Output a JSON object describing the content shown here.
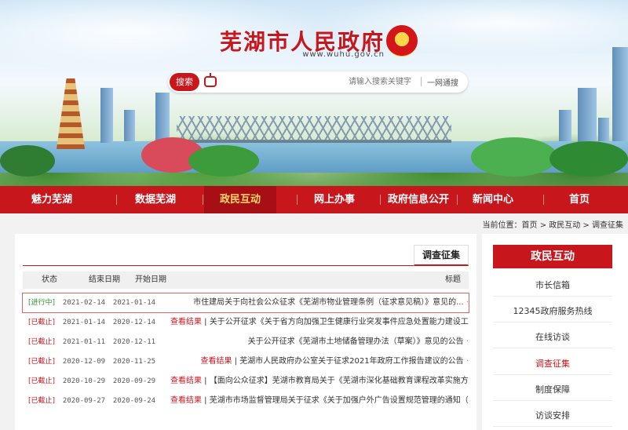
{
  "site": {
    "name": "芜湖市人民政府",
    "url": "www.wuhu.gov.cn"
  },
  "search": {
    "button_label": "搜索",
    "placeholder": "请输入搜索关键字",
    "scope_label": "一网通搜"
  },
  "nav": {
    "items": [
      {
        "label": "首页"
      },
      {
        "label": "新闻中心"
      },
      {
        "label": "政府信息公开"
      },
      {
        "label": "网上办事"
      },
      {
        "label": "政民互动",
        "active": true
      },
      {
        "label": "数据芜湖"
      },
      {
        "label": "魅力芜湖"
      }
    ]
  },
  "breadcrumb": "当前位置：首页 > 政民互动 > 调查征集",
  "sidebar": {
    "title": "政民互动",
    "items": [
      {
        "label": "市长信箱"
      },
      {
        "label": "12345政府服务热线"
      },
      {
        "label": "在线访谈"
      },
      {
        "label": "调查征集",
        "active": true
      },
      {
        "label": "制度保障"
      },
      {
        "label": "访谈安排"
      }
    ]
  },
  "main": {
    "tab_label": "调查征集",
    "columns": {
      "title": "标题",
      "start": "开始日期",
      "end": "结束日期",
      "status": "状态"
    },
    "rows": [
      {
        "title": "市住建局关于向社会公众征求《芜湖市物业管理条例（征求意见稿）》意见的...",
        "result": "",
        "start": "2021-01-14",
        "end": "2021-02-14",
        "status": "[进行中]",
        "status_color": "green",
        "highlight": true
      },
      {
        "title": "关于公开征求《关于省方向加强卫生健康行业突发事件应急处置能力建设工作计划的...",
        "result": "查看结果",
        "start": "2020-12-14",
        "end": "2021-01-14",
        "status": "[已截止]",
        "status_color": "red"
      },
      {
        "title": "关于公开征求《芜湖市土地储备管理办法（草案）》意见的公告",
        "result": "",
        "start": "2020-12-11",
        "end": "2021-01-11",
        "status": "[已截止]",
        "status_color": "red"
      },
      {
        "title": "芜湖市人民政府办公室关于征求2021年政府工作报告建议的公告",
        "result": "查看结果",
        "start": "2020-11-25",
        "end": "2020-12-09",
        "status": "[已截止]",
        "status_color": "red"
      },
      {
        "title": "【面向公众征求】芜湖市教育局关于《芜湖市深化基础教育课程改革实施方案...",
        "result": "查看结果",
        "start": "2020-09-29",
        "end": "2020-10-29",
        "status": "[已截止]",
        "status_color": "red"
      },
      {
        "title": "芜湖市市场监督管理局关于征求《关于加强户外广告设置规范管理的通知（征求...",
        "result": "查看结果",
        "start": "2020-09-24",
        "end": "2020-09-27",
        "status": "[已截止]",
        "status_color": "red"
      }
    ]
  },
  "colors": {
    "brand_red": "#c8161d",
    "active_nav_text": "#ffd96b",
    "status_ongoing": "#2e9a2e"
  }
}
